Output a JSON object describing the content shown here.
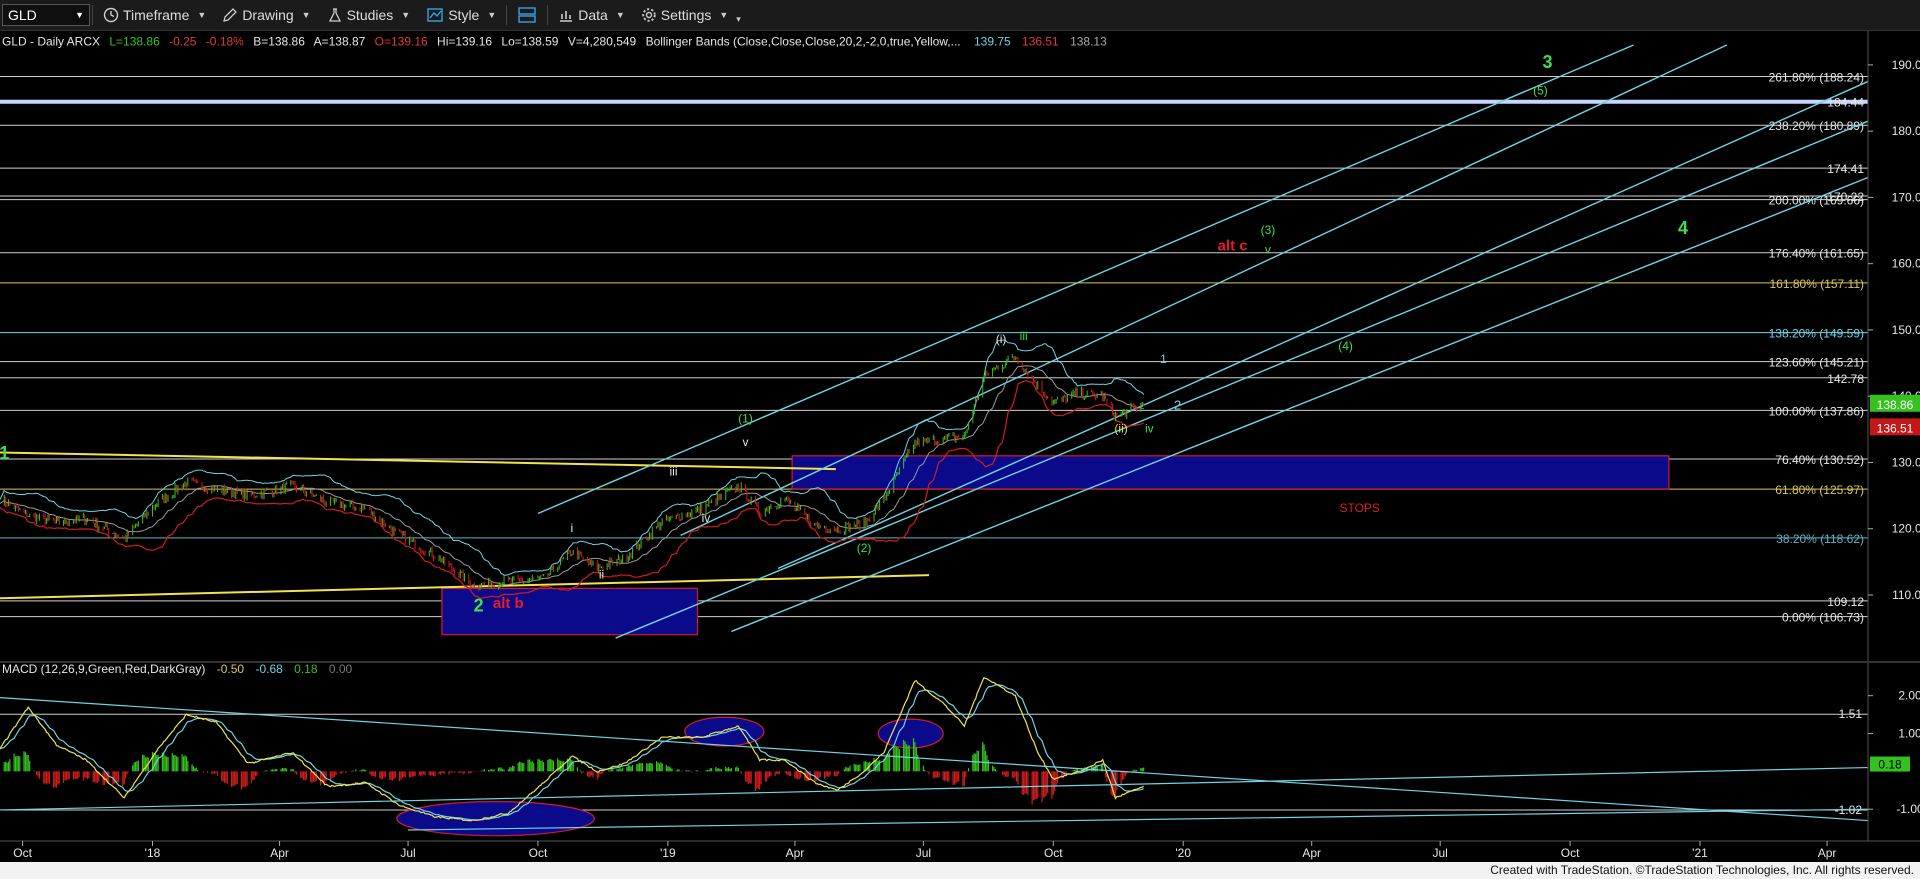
{
  "toolbar": {
    "symbol": "GLD",
    "items": [
      {
        "label": "Timeframe",
        "icon": "clock-icon"
      },
      {
        "label": "Drawing",
        "icon": "pencil-icon"
      },
      {
        "label": "Studies",
        "icon": "flask-icon"
      },
      {
        "label": "Style",
        "icon": "style-icon"
      },
      {
        "label": "",
        "icon": "layout-icon"
      },
      {
        "label": "Data",
        "icon": "bar-chart-icon"
      },
      {
        "label": "Settings",
        "icon": "gear-icon"
      }
    ]
  },
  "header": {
    "title": "GLD - Daily  ARCX",
    "L": "L=138.86",
    "chg": "-0.25",
    "pct": "-0.18%",
    "B": "B=138.86",
    "A": "A=138.87",
    "O": "O=139.16",
    "Hi": "Hi=139.16",
    "Lo": "Lo=138.59",
    "V": "V=4,280,549",
    "study": "Bollinger Bands (Close,Close,Close,20,2,-2,0,true,Yellow,...",
    "bb_upper": "139.75",
    "bb_lower": "136.51",
    "bb_mid": "138.13"
  },
  "macd_header": {
    "title": "MACD (12,26,9,Green,Red,DarkGray)",
    "v1": "-0.50",
    "v2": "-0.68",
    "v3": "0.18",
    "v4": "0.00"
  },
  "footer": {
    "text": "Created with TradeStation. ©TradeStation Technologies, Inc. All rights reserved."
  },
  "colors": {
    "up": "#35c21f",
    "down": "#d11d1d",
    "cyan": "#6fd3e6",
    "yellow": "#f1e44a",
    "fib": "#d8d8d8",
    "wave_green": "#3de04a",
    "wave_red": "#e11d2a",
    "box": "#0a0a8a"
  },
  "chart_data": [
    {
      "type": "line",
      "name": "price",
      "ylim": [
        102,
        193
      ],
      "yticks": [
        110,
        120,
        130,
        140,
        150,
        160,
        170,
        180,
        190
      ],
      "xlim": [
        "2017-09-15",
        "2021-04-30"
      ],
      "xticks": [
        {
          "date": "2017-10-01",
          "label": "Oct"
        },
        {
          "date": "2018-01-01",
          "label": "'18"
        },
        {
          "date": "2018-04-01",
          "label": "Apr"
        },
        {
          "date": "2018-07-01",
          "label": "Jul"
        },
        {
          "date": "2018-10-01",
          "label": "Oct"
        },
        {
          "date": "2019-01-01",
          "label": "'19"
        },
        {
          "date": "2019-04-01",
          "label": "Apr"
        },
        {
          "date": "2019-07-01",
          "label": "Jul"
        },
        {
          "date": "2019-10-01",
          "label": "Oct"
        },
        {
          "date": "2020-01-01",
          "label": "'20"
        },
        {
          "date": "2020-04-01",
          "label": "Apr"
        },
        {
          "date": "2020-07-01",
          "label": "Jul"
        },
        {
          "date": "2020-10-01",
          "label": "Oct"
        },
        {
          "date": "2021-01-01",
          "label": "'21"
        },
        {
          "date": "2021-04-01",
          "label": "Apr"
        }
      ],
      "price_path": [
        [
          "2017-09-15",
          124.5
        ],
        [
          "2017-10-05",
          122
        ],
        [
          "2017-10-25",
          121
        ],
        [
          "2017-11-15",
          121.5
        ],
        [
          "2017-12-12",
          118.5
        ],
        [
          "2018-01-05",
          124
        ],
        [
          "2018-01-25",
          127
        ],
        [
          "2018-02-15",
          126
        ],
        [
          "2018-03-10",
          125
        ],
        [
          "2018-04-10",
          126.5
        ],
        [
          "2018-05-05",
          124
        ],
        [
          "2018-06-01",
          123
        ],
        [
          "2018-06-25",
          119
        ],
        [
          "2018-07-20",
          116
        ],
        [
          "2018-08-16",
          111.5
        ],
        [
          "2018-09-10",
          112
        ],
        [
          "2018-10-05",
          112.5
        ],
        [
          "2018-10-25",
          116.5
        ],
        [
          "2018-11-12",
          114
        ],
        [
          "2018-12-01",
          115.5
        ],
        [
          "2018-12-28",
          121
        ],
        [
          "2019-01-25",
          123
        ],
        [
          "2019-02-20",
          126.5
        ],
        [
          "2019-03-07",
          122.5
        ],
        [
          "2019-03-25",
          124.5
        ],
        [
          "2019-04-15",
          120.5
        ],
        [
          "2019-05-01",
          120
        ],
        [
          "2019-05-20",
          120.8
        ],
        [
          "2019-06-03",
          124.5
        ],
        [
          "2019-06-25",
          133
        ],
        [
          "2019-07-15",
          133.5
        ],
        [
          "2019-07-30",
          134
        ],
        [
          "2019-08-13",
          143
        ],
        [
          "2019-09-04",
          146
        ],
        [
          "2019-09-20",
          141.5
        ],
        [
          "2019-10-01",
          139
        ],
        [
          "2019-10-20",
          140.5
        ],
        [
          "2019-11-05",
          140
        ],
        [
          "2019-11-14",
          137
        ],
        [
          "2019-12-04",
          138.8
        ]
      ],
      "hlines": [
        {
          "value": 188.24,
          "label": "261.80% (188.24)"
        },
        {
          "value": 184.44,
          "label": "184.44",
          "thick": true
        },
        {
          "value": 180.89,
          "label": "238.20% (180.89)"
        },
        {
          "value": 174.41,
          "label": "174.41"
        },
        {
          "value": 170.22,
          "label": "170.22"
        },
        {
          "value": 169.66,
          "label": "200.00% (169.66)"
        },
        {
          "value": 161.65,
          "label": "176.40% (161.65)"
        },
        {
          "value": 157.11,
          "label": "161.80% (157.11)",
          "color": "#d9c75a"
        },
        {
          "value": 149.59,
          "label": "138.20% (149.59)",
          "color": "#6fd3e6"
        },
        {
          "value": 145.21,
          "label": "123.60% (145.21)"
        },
        {
          "value": 142.78,
          "label": "142.78"
        },
        {
          "value": 137.86,
          "label": "100.00% (137.86)"
        },
        {
          "value": 130.52,
          "label": "76.40% (130.52)"
        },
        {
          "value": 125.97,
          "label": "61.80% (125.97)",
          "color": "#d9c75a"
        },
        {
          "value": 118.62,
          "label": "38.20% (118.62)",
          "color": "#5fb4c4"
        },
        {
          "value": 109.12,
          "label": "109.12"
        },
        {
          "value": 106.73,
          "label": "0.00% (106.73)"
        }
      ],
      "last_price": "138.86",
      "bb_label": "136.51",
      "annotations": [
        {
          "text": "1",
          "date": "2017-09-18",
          "value": 130.5,
          "color": "green",
          "size": 18
        },
        {
          "text": "2",
          "date": "2018-08-20",
          "value": 107.5,
          "color": "green",
          "size": 18
        },
        {
          "text": "alt b",
          "date": "2018-09-10",
          "value": 108,
          "color": "red",
          "size": 15
        },
        {
          "text": "i",
          "date": "2018-10-25",
          "value": 119.5,
          "color": "white",
          "size": 12
        },
        {
          "text": "ii",
          "date": "2018-11-15",
          "value": 112.5,
          "color": "white",
          "size": 12
        },
        {
          "text": "iii",
          "date": "2019-01-05",
          "value": 128,
          "color": "white",
          "size": 12
        },
        {
          "text": "iv",
          "date": "2019-01-28",
          "value": 121,
          "color": "white",
          "size": 12
        },
        {
          "text": "(1)",
          "date": "2019-02-25",
          "value": 136,
          "color": "green",
          "size": 12
        },
        {
          "text": "v",
          "date": "2019-02-25",
          "value": 132.5,
          "color": "white",
          "size": 12
        },
        {
          "text": "(2)",
          "date": "2019-05-20",
          "value": 116.5,
          "color": "green",
          "size": 12
        },
        {
          "text": "(i)",
          "date": "2019-08-25",
          "value": 148,
          "color": "white",
          "size": 12
        },
        {
          "text": "iii",
          "date": "2019-09-10",
          "value": 148.5,
          "color": "green",
          "size": 12
        },
        {
          "text": "(ii)",
          "date": "2019-11-18",
          "value": 134.5,
          "color": "yellow",
          "size": 12
        },
        {
          "text": "iv",
          "date": "2019-12-08",
          "value": 134.5,
          "color": "green",
          "size": 12
        },
        {
          "text": "1",
          "date": "2019-12-18",
          "value": 145,
          "color": "cyan",
          "size": 12
        },
        {
          "text": "2",
          "date": "2019-12-28",
          "value": 138,
          "color": "cyan",
          "size": 13
        },
        {
          "text": "alt c",
          "date": "2020-02-05",
          "value": 162,
          "color": "red",
          "size": 15
        },
        {
          "text": "(3)",
          "date": "2020-03-01",
          "value": 164.5,
          "color": "green",
          "size": 12
        },
        {
          "text": "v",
          "date": "2020-03-01",
          "value": 161.5,
          "color": "green",
          "size": 12
        },
        {
          "text": "(4)",
          "date": "2020-04-25",
          "value": 147,
          "color": "green",
          "size": 12
        },
        {
          "text": "(5)",
          "date": "2020-09-10",
          "value": 185.5,
          "color": "green",
          "size": 12
        },
        {
          "text": "3",
          "date": "2020-09-15",
          "value": 189.5,
          "color": "green",
          "size": 18
        },
        {
          "text": "4",
          "date": "2020-12-20",
          "value": 164.5,
          "color": "green",
          "size": 18
        },
        {
          "text": "STOPS",
          "date": "2020-05-05",
          "value": 122.5,
          "color": "red",
          "size": 12
        }
      ],
      "boxes": [
        {
          "from": "2019-03-30",
          "to": "2020-12-10",
          "top": 131.0,
          "bottom": 126.0
        },
        {
          "from": "2018-07-25",
          "to": "2019-01-22",
          "top": 111.0,
          "bottom": 104.0
        }
      ],
      "yellow_lines": [
        {
          "from": [
            "2017-09-15",
            131.5
          ],
          "to": [
            "2019-04-30",
            129.0
          ]
        },
        {
          "from": [
            "2017-09-15",
            109.5
          ],
          "to": [
            "2019-07-05",
            113.0
          ]
        }
      ],
      "channel_lines": [
        {
          "from": [
            "2018-10-01",
            122.3
          ],
          "to": [
            "2020-11-15",
            193.0
          ]
        },
        {
          "from": [
            "2019-01-10",
            119.0
          ],
          "to": [
            "2021-01-20",
            193.0
          ]
        },
        {
          "from": [
            "2019-03-20",
            114.0
          ],
          "to": [
            "2021-04-30",
            187.5
          ]
        },
        {
          "from": [
            "2019-02-15",
            104.5
          ],
          "to": [
            "2021-04-30",
            173.0
          ]
        },
        {
          "from": [
            "2018-11-25",
            103.5
          ],
          "to": [
            "2021-04-30",
            181.5
          ]
        }
      ]
    },
    {
      "type": "line",
      "name": "MACD",
      "ylim": [
        -1.55,
        2.6
      ],
      "yticks": [
        2.0,
        1.0,
        -1.0
      ],
      "ytick_labels": [
        "2.00",
        "1.00",
        "-1.00"
      ],
      "hlines": [
        {
          "value": 1.51,
          "label": "1.51"
        },
        {
          "value": -1.02,
          "label": "-1.02"
        }
      ],
      "last_value": "0.18",
      "macd_path": [
        [
          "2017-09-15",
          0.6
        ],
        [
          "2017-10-05",
          1.7
        ],
        [
          "2017-10-25",
          0.7
        ],
        [
          "2017-11-15",
          0.3
        ],
        [
          "2017-12-12",
          -0.7
        ],
        [
          "2018-01-05",
          0.6
        ],
        [
          "2018-01-25",
          1.5
        ],
        [
          "2018-02-15",
          1.3
        ],
        [
          "2018-03-10",
          0.2
        ],
        [
          "2018-04-10",
          0.5
        ],
        [
          "2018-05-05",
          -0.4
        ],
        [
          "2018-06-01",
          -0.3
        ],
        [
          "2018-06-25",
          -0.9
        ],
        [
          "2018-07-20",
          -1.2
        ],
        [
          "2018-08-16",
          -1.3
        ],
        [
          "2018-09-10",
          -1.1
        ],
        [
          "2018-10-05",
          -0.3
        ],
        [
          "2018-10-25",
          0.4
        ],
        [
          "2018-11-12",
          0.0
        ],
        [
          "2018-12-01",
          0.2
        ],
        [
          "2018-12-28",
          0.9
        ],
        [
          "2019-01-25",
          0.9
        ],
        [
          "2019-02-20",
          1.2
        ],
        [
          "2019-03-07",
          0.3
        ],
        [
          "2019-03-25",
          0.3
        ],
        [
          "2019-04-15",
          -0.3
        ],
        [
          "2019-05-01",
          -0.5
        ],
        [
          "2019-05-20",
          0.0
        ],
        [
          "2019-06-03",
          0.5
        ],
        [
          "2019-06-25",
          2.4
        ],
        [
          "2019-07-15",
          1.8
        ],
        [
          "2019-07-30",
          1.2
        ],
        [
          "2019-08-13",
          2.5
        ],
        [
          "2019-09-04",
          2.0
        ],
        [
          "2019-09-20",
          0.5
        ],
        [
          "2019-10-01",
          -0.2
        ],
        [
          "2019-10-20",
          0.0
        ],
        [
          "2019-11-05",
          0.3
        ],
        [
          "2019-11-14",
          -0.7
        ],
        [
          "2019-12-04",
          -0.4
        ]
      ],
      "ellipses": [
        {
          "center": [
            "2018-09-01",
            -1.25
          ],
          "rx_days": 70,
          "ry": 0.45
        },
        {
          "center": [
            "2019-02-10",
            1.05
          ],
          "rx_days": 28,
          "ry": 0.38
        },
        {
          "center": [
            "2019-06-22",
            1.0
          ],
          "rx_days": 23,
          "ry": 0.38
        }
      ],
      "trend_lines": [
        {
          "from": [
            "2017-09-15",
            1.95
          ],
          "to": [
            "2021-04-30",
            -1.3
          ]
        },
        {
          "from": [
            "2017-09-15",
            -1.02
          ],
          "to": [
            "2021-04-30",
            0.1
          ]
        },
        {
          "from": [
            "2018-07-01",
            -1.55
          ],
          "to": [
            "2021-04-30",
            -1.0
          ]
        }
      ]
    }
  ]
}
